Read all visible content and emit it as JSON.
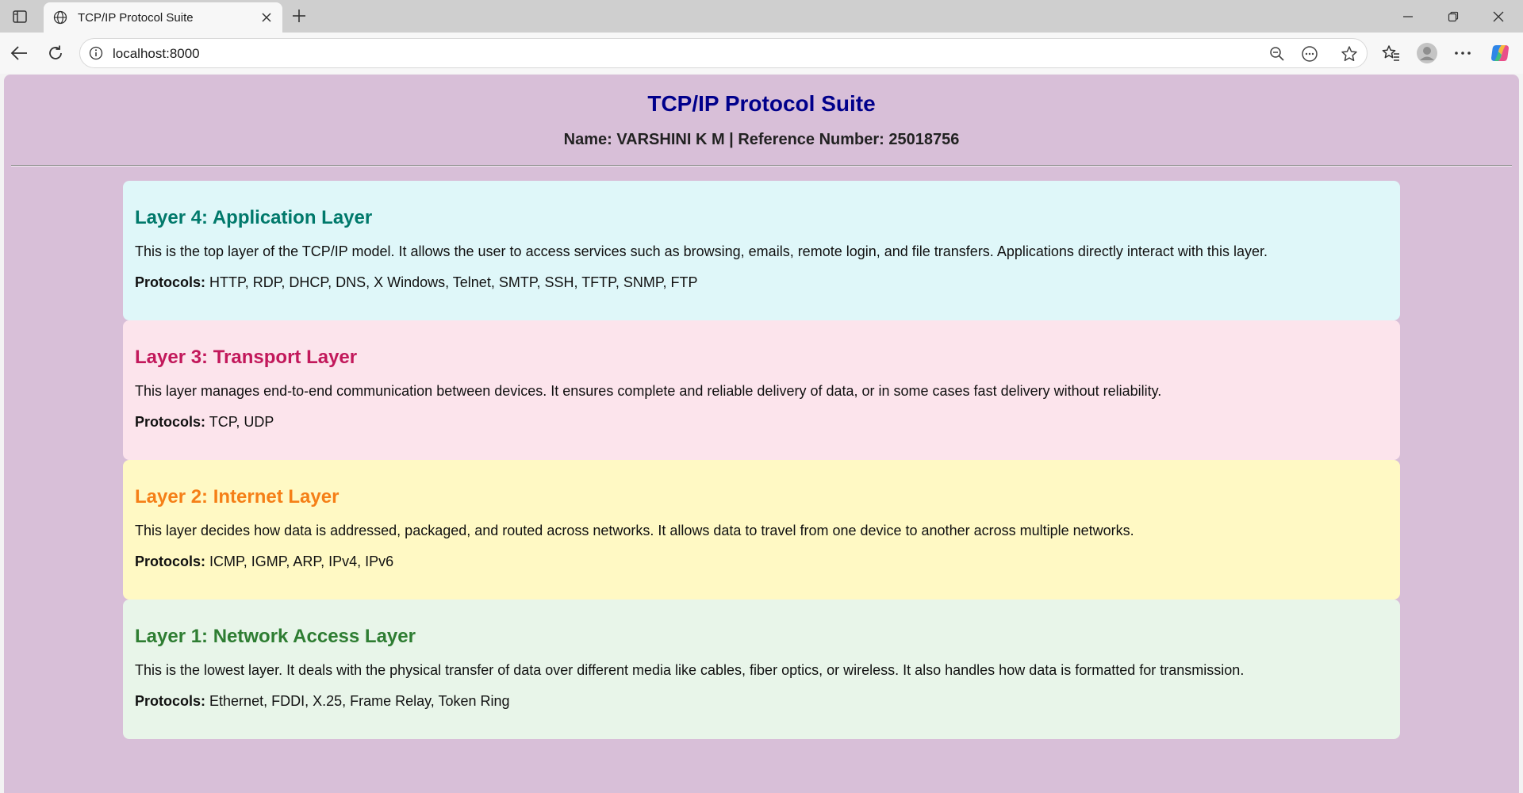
{
  "browser": {
    "tab_title": "TCP/IP Protocol Suite",
    "url": "localhost:8000"
  },
  "page": {
    "title": "TCP/IP Protocol Suite",
    "subtitle": "Name: VARSHINI K M | Reference Number: 25018756"
  },
  "layers": [
    {
      "title": "Layer 4: Application Layer",
      "description": "This is the top layer of the TCP/IP model. It allows the user to access services such as browsing, emails, remote login, and file transfers. Applications directly interact with this layer.",
      "protocols_label": "Protocols:",
      "protocols": "HTTP, RDP, DHCP, DNS, X Windows, Telnet, SMTP, SSH, TFTP, SNMP, FTP",
      "bg_color": "#dff7f9",
      "title_color": "#00796b"
    },
    {
      "title": "Layer 3: Transport Layer",
      "description": "This layer manages end-to-end communication between devices. It ensures complete and reliable delivery of data, or in some cases fast delivery without reliability.",
      "protocols_label": "Protocols:",
      "protocols": "TCP, UDP",
      "bg_color": "#fce4ec",
      "title_color": "#c2185b"
    },
    {
      "title": "Layer 2: Internet Layer",
      "description": "This layer decides how data is addressed, packaged, and routed across networks. It allows data to travel from one device to another across multiple networks.",
      "protocols_label": "Protocols:",
      "protocols": "ICMP, IGMP, ARP, IPv4, IPv6",
      "bg_color": "#fff9c4",
      "title_color": "#f57f17"
    },
    {
      "title": "Layer 1: Network Access Layer",
      "description": "This is the lowest layer. It deals with the physical transfer of data over different media like cables, fiber optics, or wireless. It also handles how data is formatted for transmission.",
      "protocols_label": "Protocols:",
      "protocols": "Ethernet, FDDI, X.25, Frame Relay, Token Ring",
      "bg_color": "#e8f5e9",
      "title_color": "#2e7d32"
    }
  ]
}
